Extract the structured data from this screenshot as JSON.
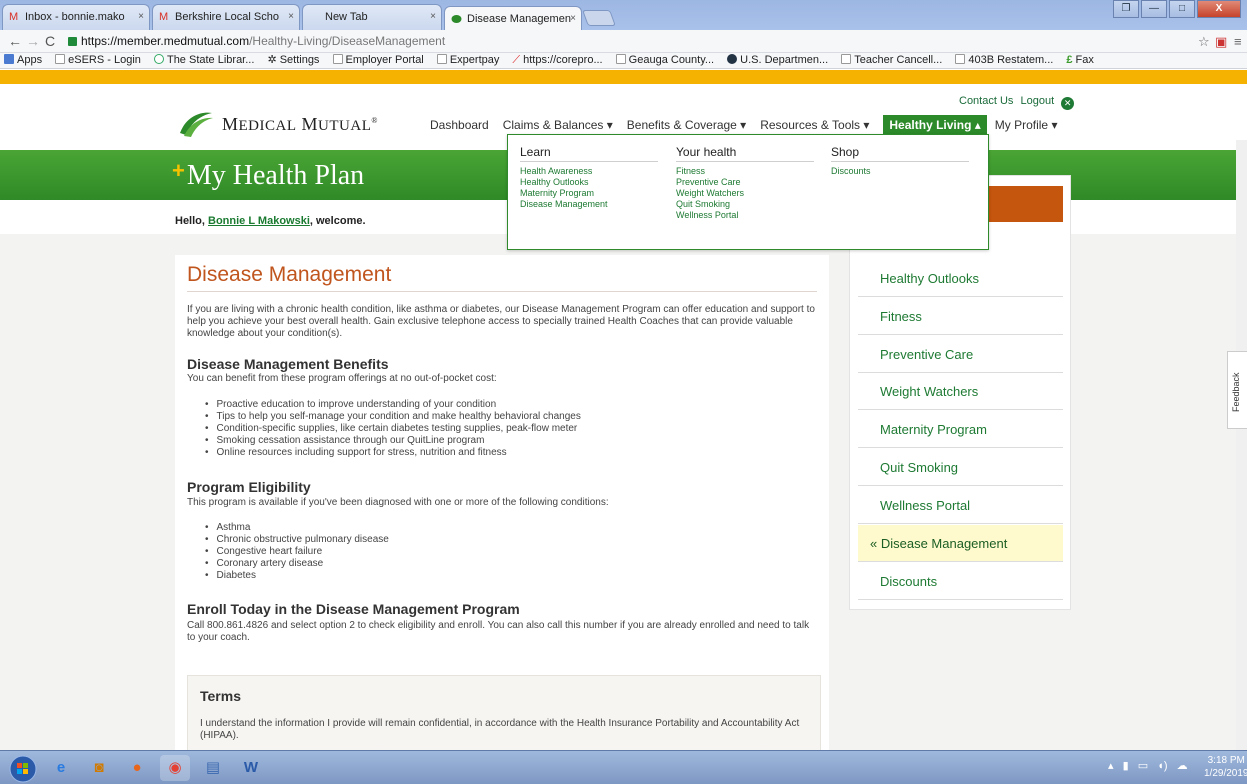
{
  "browser": {
    "tabs": [
      {
        "title": "Inbox - bonnie.mako",
        "icon": "gmail-icon",
        "color": "#d93025"
      },
      {
        "title": "Berkshire Local Scho",
        "icon": "gmail-icon",
        "color": "#d93025"
      },
      {
        "title": "New Tab",
        "icon": "",
        "color": ""
      },
      {
        "title": "Disease Managemen",
        "icon": "medical-mutual-icon",
        "color": "#2c8a2a"
      }
    ],
    "url_host": "https://member.medmutual.com",
    "url_path": "/Healthy-Living/DiseaseManagement",
    "bookmarks": [
      "Apps",
      "eSERS - Login",
      "The State Librar...",
      "Settings",
      "Employer Portal",
      "Expertpay",
      "https://corepro...",
      "Geauga County...",
      "U.S. Departmen...",
      "Teacher Cancell...",
      "403B Restatem...",
      "Fax"
    ]
  },
  "header": {
    "logo_text": "Medical Mutual",
    "contact_us": "Contact Us",
    "logout": "Logout",
    "nav": [
      "Dashboard",
      "Claims & Balances ▾",
      "Benefits & Coverage ▾",
      "Resources & Tools ▾",
      "Healthy Living ▴",
      "My Profile ▾"
    ],
    "plan_title": "My Health Plan",
    "hello_prefix": "Hello,",
    "user_name": "Bonnie L Makowski",
    "hello_suffix": ", welcome."
  },
  "dropdown": {
    "columns": [
      {
        "heading": "Learn",
        "links": [
          "Health Awareness",
          "Healthy Outlooks",
          "Maternity Program",
          "Disease Management"
        ]
      },
      {
        "heading": "Your health",
        "links": [
          "Fitness",
          "Preventive Care",
          "Weight Watchers",
          "Quit Smoking",
          "Wellness Portal"
        ]
      },
      {
        "heading": "Shop",
        "links": [
          "Discounts"
        ]
      }
    ]
  },
  "content": {
    "title": "Disease Management",
    "intro": "If you are living with a chronic health condition, like asthma or diabetes, our Disease Management Program can offer education and support to help you achieve your best overall health. Gain exclusive telephone access to specially trained Health Coaches that can provide valuable knowledge about your condition(s).",
    "benefits_heading": "Disease Management Benefits",
    "benefits_intro": "You can benefit from these program offerings at no out-of-pocket cost:",
    "benefits": [
      "Proactive education to improve understanding of your condition",
      "Tips to help you self-manage your condition and make healthy behavioral changes",
      "Condition-specific supplies, like certain diabetes testing supplies, peak-flow meter",
      "Smoking cessation assistance through our QuitLine program",
      "Online resources including support for stress, nutrition and fitness"
    ],
    "eligibility_heading": "Program Eligibility",
    "eligibility_intro": "This program is available if you've been diagnosed with one or more of the following conditions:",
    "conditions": [
      "Asthma",
      "Chronic obstructive pulmonary disease",
      "Congestive heart failure",
      "Coronary artery disease",
      "Diabetes"
    ],
    "enroll_heading": "Enroll Today in the Disease Management Program",
    "enroll_text": "Call 800.861.4826 and select option 2 to check eligibility and enroll. You can also call this number if you are already enrolled and need to talk to your coach.",
    "terms_heading": "Terms",
    "terms_text": "I understand the information I provide will remain confidential, in accordance with the Health Insurance Portability and Accountability Act (HIPAA)."
  },
  "sidebar": {
    "items": [
      "Healthy Outlooks",
      "Fitness",
      "Preventive Care",
      "Weight Watchers",
      "Maternity Program",
      "Quit Smoking",
      "Wellness Portal",
      "« Disease Management",
      "Discounts"
    ],
    "current_index": 7
  },
  "feedback_label": "Feedback",
  "taskbar": {
    "time": "3:18 PM",
    "date": "1/29/2019"
  },
  "colors": {
    "brand_green": "#2c8a2a",
    "accent_orange": "#c0551e",
    "top_stripe": "#f6b200"
  }
}
